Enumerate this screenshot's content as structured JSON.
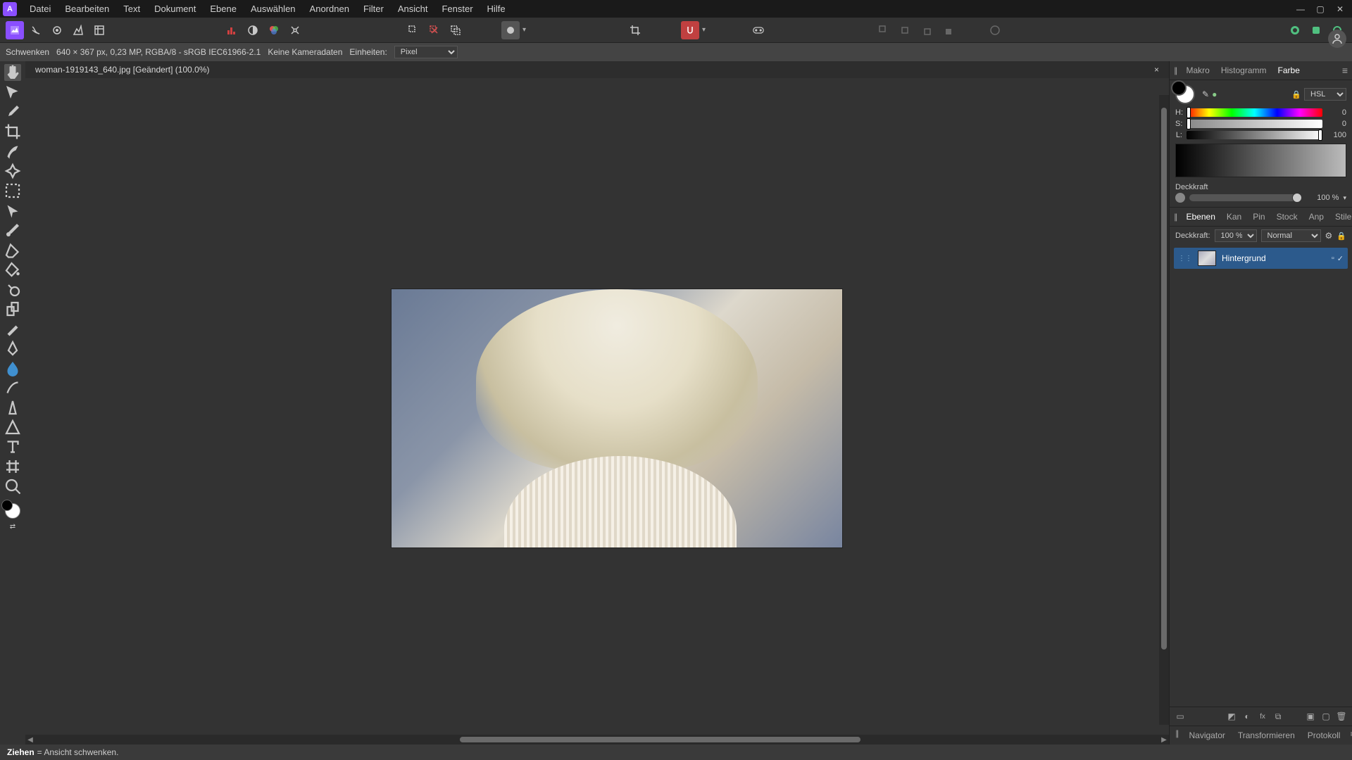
{
  "menu": [
    "Datei",
    "Bearbeiten",
    "Text",
    "Dokument",
    "Ebene",
    "Auswählen",
    "Anordnen",
    "Filter",
    "Ansicht",
    "Fenster",
    "Hilfe"
  ],
  "infobar": {
    "tool": "Schwenken",
    "dims": "640 × 367 px, 0,23 MP, RGBA/8 - sRGB IEC61966-2.1",
    "camera": "Keine Kameradaten",
    "units_label": "Einheiten:",
    "units_value": "Pixel"
  },
  "doc_tab": {
    "title": "woman-1919143_640.jpg [Geändert] (100.0%)"
  },
  "right": {
    "top_tabs": [
      "Makro",
      "Histogramm",
      "Farbe"
    ],
    "top_active": "Farbe",
    "color_model": "HSL",
    "h_label": "H:",
    "s_label": "S:",
    "l_label": "L:",
    "h_val": "0",
    "s_val": "0",
    "l_val": "100",
    "opacity_label": "Deckkraft",
    "opacity_val": "100 %",
    "mid_tabs": [
      "Ebenen",
      "Kan",
      "Pin",
      "Stock",
      "Anp",
      "Stile"
    ],
    "mid_active": "Ebenen",
    "layer_opacity_label": "Deckkraft:",
    "layer_opacity_val": "100 %",
    "blend_mode": "Normal",
    "layer_name": "Hintergrund",
    "bottom_tabs": [
      "Navigator",
      "Transformieren",
      "Protokoll"
    ]
  },
  "status": {
    "bold": "Ziehen",
    "rest": " = Ansicht schwenken."
  },
  "persona_icons": [
    "photo-persona",
    "liquify-persona",
    "develop-persona",
    "tonemap-persona",
    "export-persona"
  ]
}
